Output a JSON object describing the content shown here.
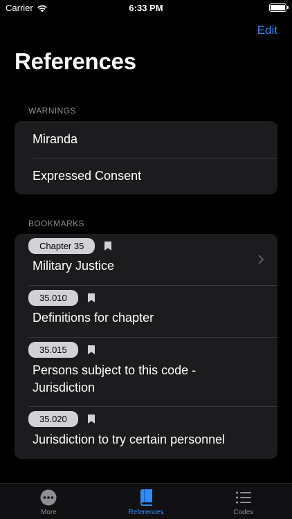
{
  "status": {
    "carrier": "Carrier",
    "time": "6:33 PM"
  },
  "nav": {
    "edit_label": "Edit",
    "title": "References"
  },
  "warnings": {
    "header": "WARNINGS",
    "items": [
      {
        "label": "Miranda"
      },
      {
        "label": "Expressed Consent"
      }
    ]
  },
  "bookmarks": {
    "header": "BOOKMARKS",
    "items": [
      {
        "badge": "Chapter 35",
        "title": "Military Justice"
      },
      {
        "badge": "35.010",
        "title": "Definitions for chapter"
      },
      {
        "badge": "35.015",
        "title": "Persons subject to this code - Jurisdiction"
      },
      {
        "badge": "35.020",
        "title": "Jurisdiction to try certain personnel"
      }
    ]
  },
  "tabs": [
    {
      "label": "More",
      "icon": "ellipsis-circle-icon"
    },
    {
      "label": "References",
      "icon": "book-icon"
    },
    {
      "label": "Codes",
      "icon": "list-icon"
    }
  ],
  "colors": {
    "accent": "#2f8bff",
    "cell": "#1c1c1e",
    "badge": "#d1d1d6",
    "secondary": "#8e8e93"
  }
}
